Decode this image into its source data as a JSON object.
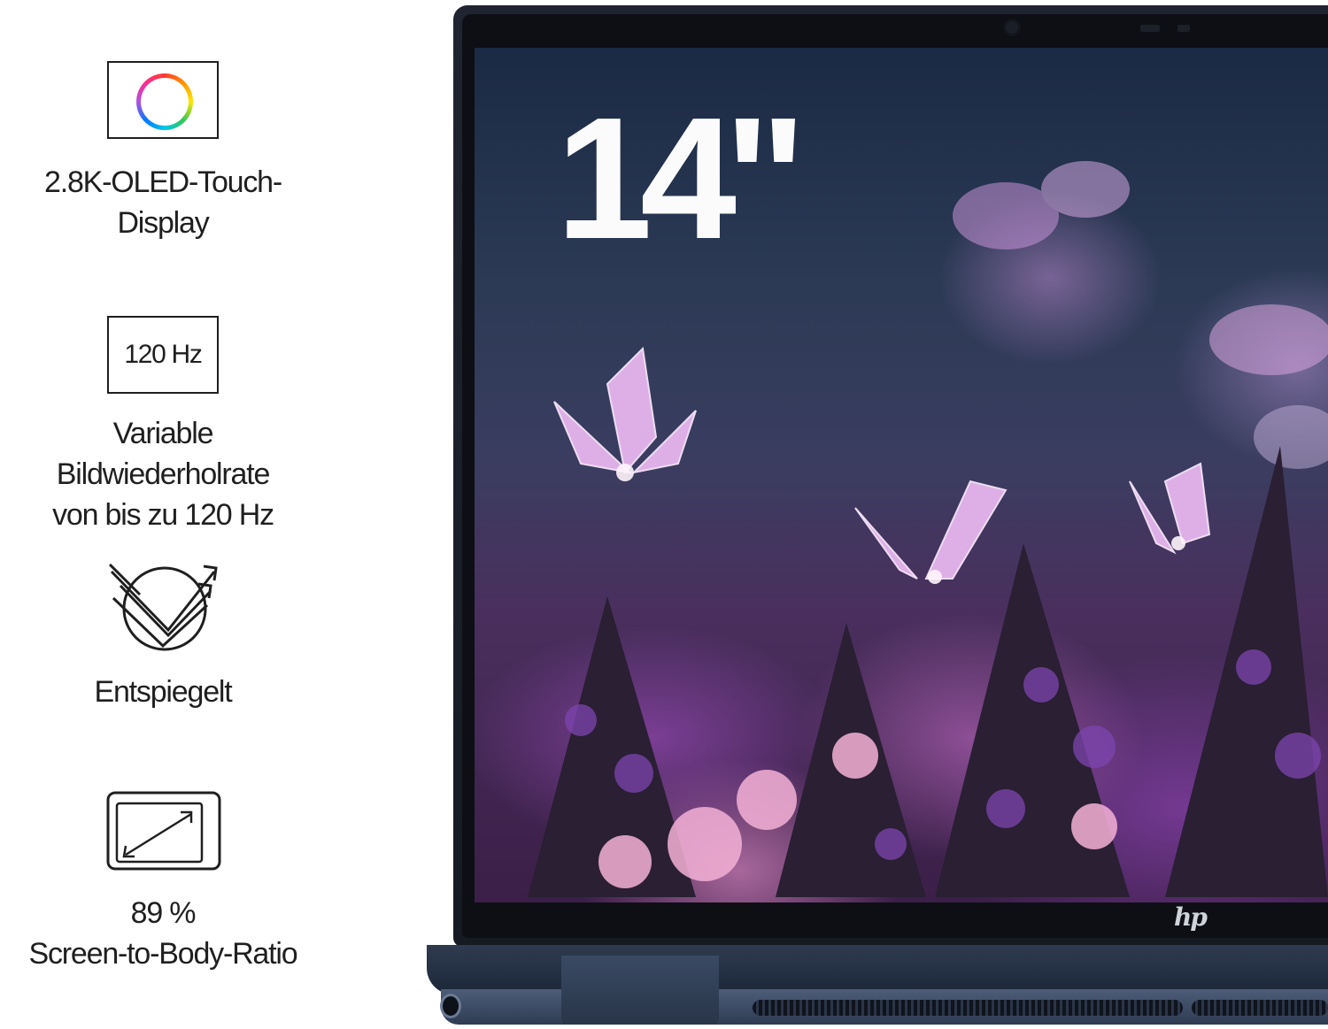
{
  "features": [
    {
      "icon": "color-ring-icon",
      "lines": [
        "2.8K-OLED-Touch-",
        "Display"
      ]
    },
    {
      "icon": "refresh-rate-icon",
      "icon_text": "120 Hz",
      "lines": [
        "Variable",
        "Bildwiederholrate",
        "von bis zu 120 Hz"
      ]
    },
    {
      "icon": "anti-glare-icon",
      "lines": [
        "Entspiegelt"
      ]
    },
    {
      "icon": "screen-ratio-icon",
      "lines": [
        "89 %",
        "Screen-to-Body-Ratio"
      ]
    }
  ],
  "laptop": {
    "screen_size_label": "14\"",
    "logo_text": "hp",
    "body_color": "#243044"
  }
}
